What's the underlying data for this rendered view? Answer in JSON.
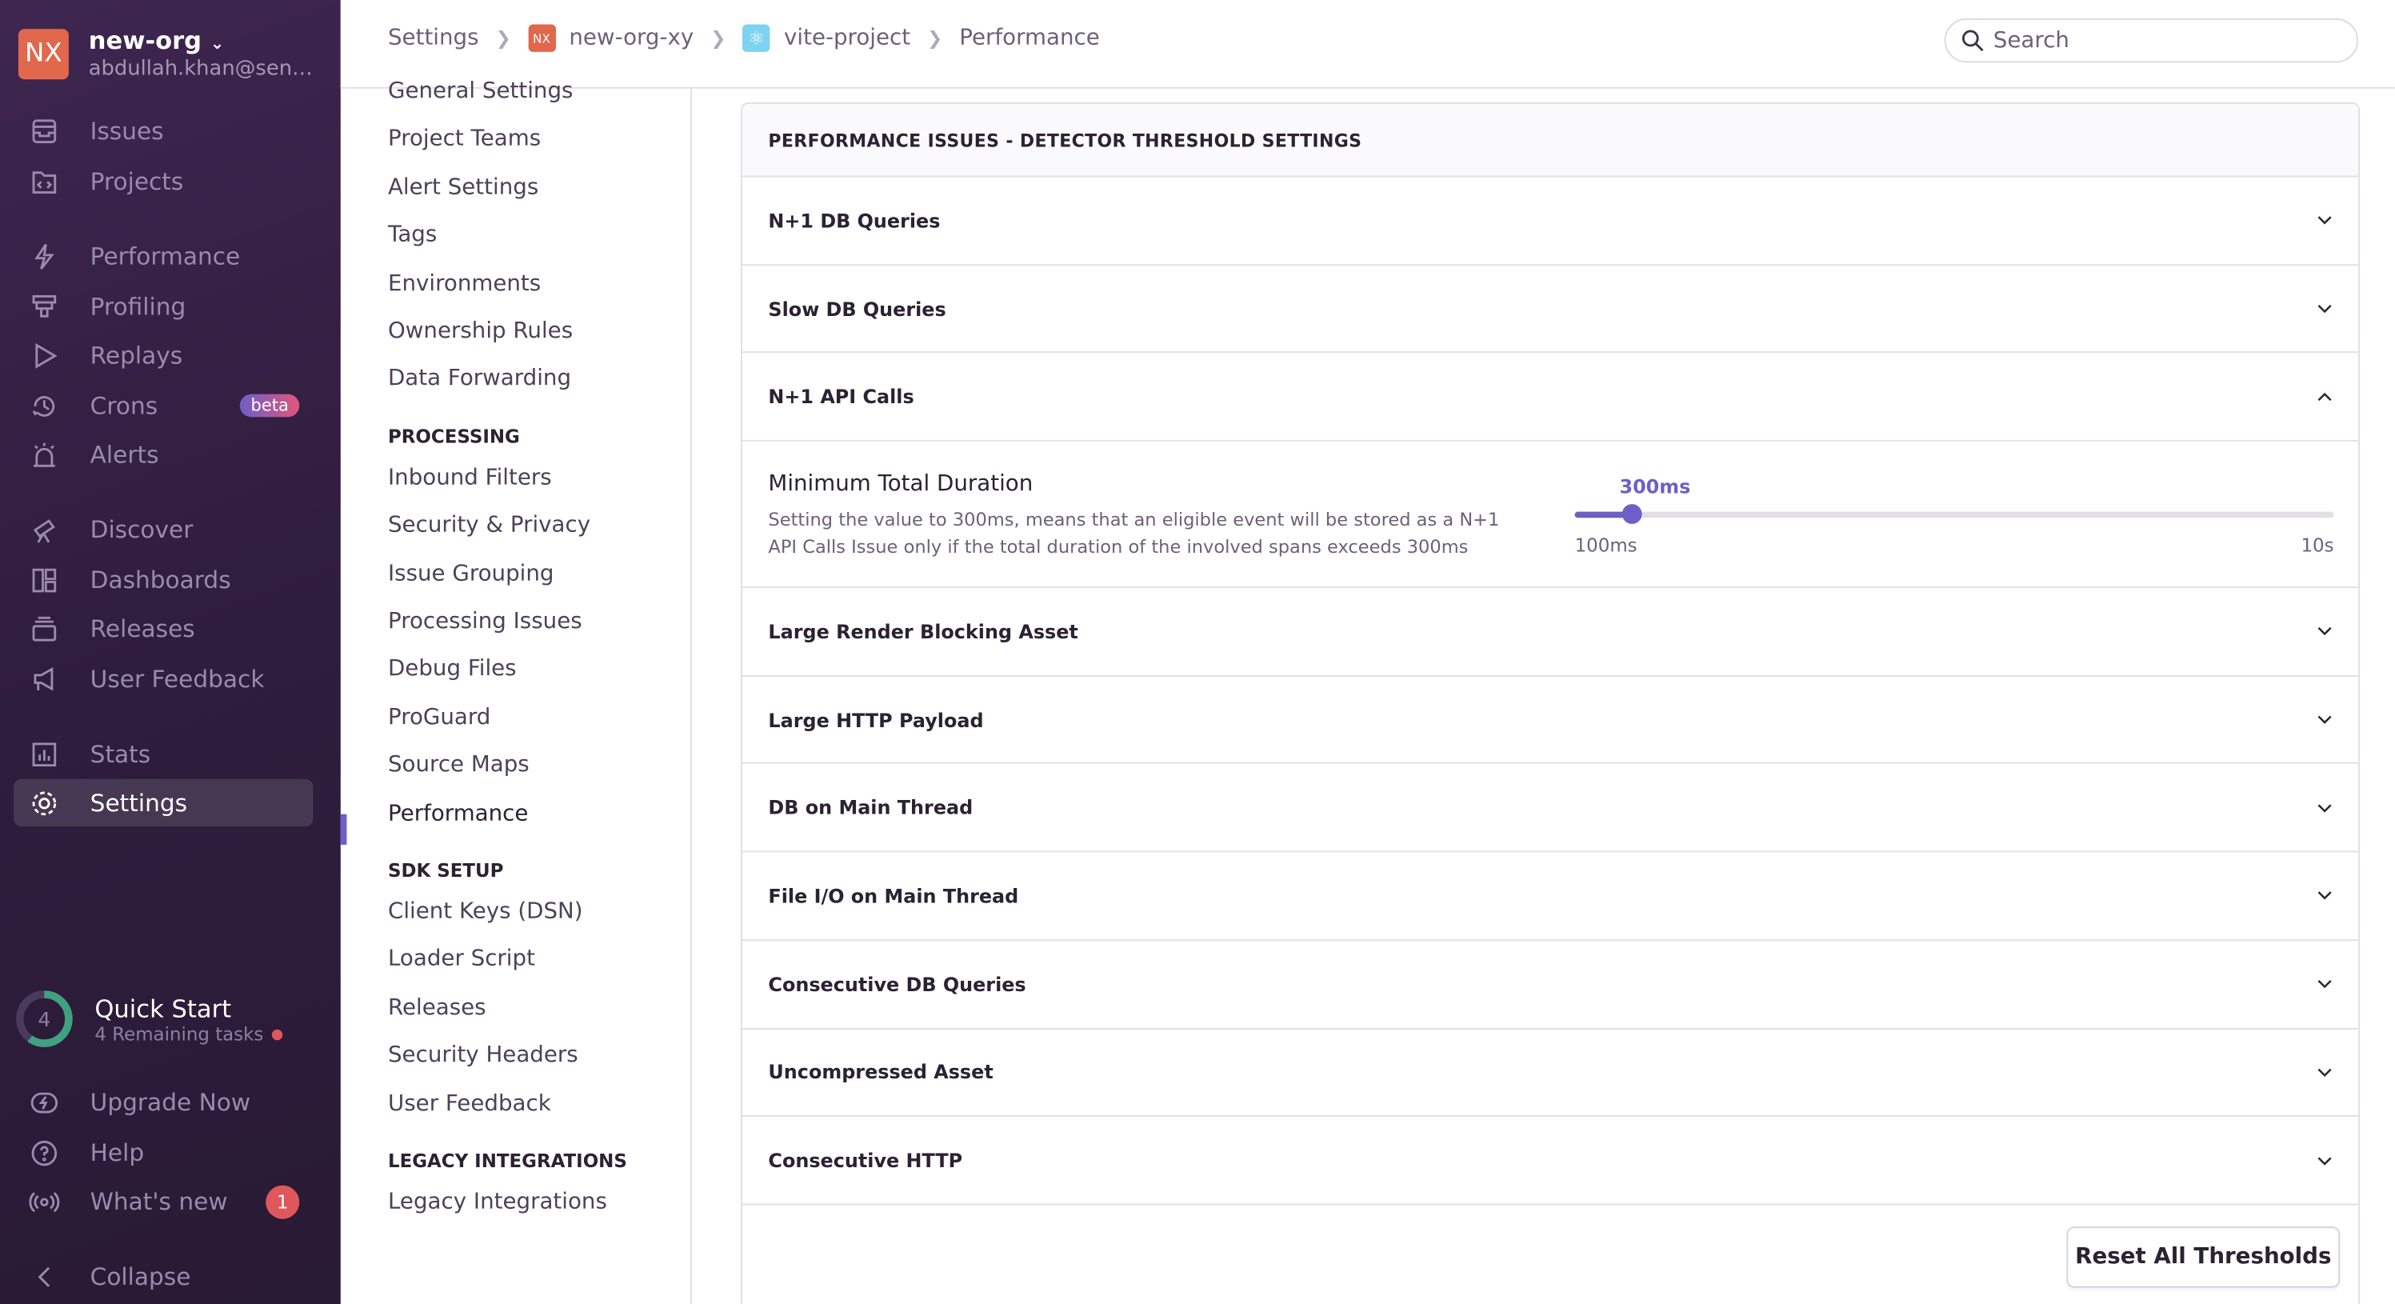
{
  "org": {
    "initials": "NX",
    "name": "new-org",
    "email": "abdullah.khan@sen…",
    "logo_color": "#e1674d"
  },
  "sidebar": {
    "items": [
      {
        "label": "Issues",
        "icon": "inbox-icon"
      },
      {
        "label": "Projects",
        "icon": "folder-code-icon"
      },
      {
        "label": "Performance",
        "icon": "lightning-icon"
      },
      {
        "label": "Profiling",
        "icon": "profiling-icon"
      },
      {
        "label": "Replays",
        "icon": "play-icon"
      },
      {
        "label": "Crons",
        "icon": "history-clock-icon",
        "badge": "beta"
      },
      {
        "label": "Alerts",
        "icon": "siren-icon"
      },
      {
        "label": "Discover",
        "icon": "telescope-icon"
      },
      {
        "label": "Dashboards",
        "icon": "dashboard-icon"
      },
      {
        "label": "Releases",
        "icon": "stack-icon"
      },
      {
        "label": "User Feedback",
        "icon": "megaphone-icon"
      },
      {
        "label": "Stats",
        "icon": "bar-chart-icon"
      },
      {
        "label": "Settings",
        "icon": "gear-icon",
        "active": true
      }
    ],
    "quick_start": {
      "title": "Quick Start",
      "count": "4",
      "subtitle": "4 Remaining tasks",
      "progress": 0.6
    },
    "bottom": [
      {
        "label": "Upgrade Now",
        "icon": "lightning-circle-icon"
      },
      {
        "label": "Help",
        "icon": "question-icon"
      },
      {
        "label": "What's new",
        "icon": "broadcast-icon",
        "badge": "1"
      },
      {
        "label": "Collapse",
        "icon": "chevron-left-icon"
      }
    ]
  },
  "breadcrumb": [
    {
      "label": "Settings"
    },
    {
      "label": "new-org-xy",
      "icon": "NX"
    },
    {
      "label": "vite-project"
    },
    {
      "label": "Performance"
    }
  ],
  "search": {
    "placeholder": "Search"
  },
  "settings_nav": {
    "items_top": [
      "General Settings",
      "Project Teams",
      "Alert Settings",
      "Tags",
      "Environments",
      "Ownership Rules",
      "Data Forwarding"
    ],
    "processing_header": "PROCESSING",
    "processing": [
      "Inbound Filters",
      "Security & Privacy",
      "Issue Grouping",
      "Processing Issues",
      "Debug Files",
      "ProGuard",
      "Source Maps",
      "Performance"
    ],
    "sdk_header": "SDK SETUP",
    "sdk": [
      "Client Keys (DSN)",
      "Loader Script",
      "Releases",
      "Security Headers",
      "User Feedback"
    ],
    "legacy_header": "LEGACY INTEGRATIONS",
    "legacy": [
      "Legacy Integrations"
    ]
  },
  "panel": {
    "title": "PERFORMANCE ISSUES - DETECTOR THRESHOLD SETTINGS",
    "rows_before": [
      "N+1 DB Queries",
      "Slow DB Queries"
    ],
    "expanded": {
      "label": "N+1 API Calls",
      "field_title": "Minimum Total Duration",
      "description": "Setting the value to 300ms, means that an eligible event will be stored as a N+1 API Calls Issue only if the total duration of the involved spans exceeds 300ms",
      "value_label": "300ms",
      "min_label": "100ms",
      "max_label": "10s",
      "fill_fraction": 0.075
    },
    "rows_after": [
      "Large Render Blocking Asset",
      "Large HTTP Payload",
      "DB on Main Thread",
      "File I/O on Main Thread",
      "Consecutive DB Queries",
      "Uncompressed Asset",
      "Consecutive HTTP"
    ],
    "reset_label": "Reset All Thresholds",
    "accent": "#6c5fc7"
  }
}
